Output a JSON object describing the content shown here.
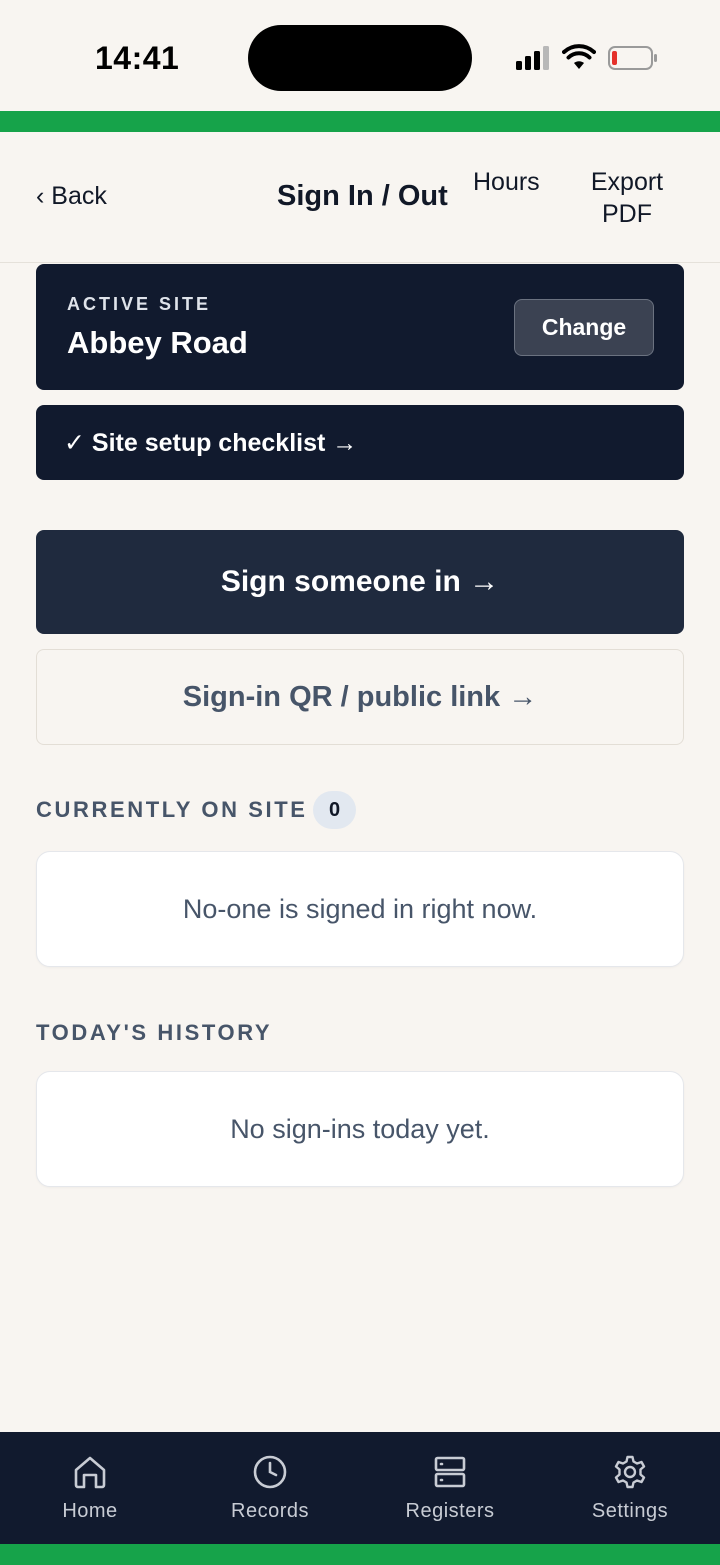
{
  "status": {
    "time": "14:41"
  },
  "header": {
    "back_label": "‹ Back",
    "title": "Sign In / Out",
    "hours_label": "Hours",
    "export_label": "Export PDF"
  },
  "active_site": {
    "label": "ACTIVE SITE",
    "name": "Abbey Road",
    "change_label": "Change"
  },
  "checklist_label": "✓ Site setup checklist →",
  "actions": {
    "sign_in_label": "Sign someone in →",
    "qr_label": "Sign-in QR / public link →"
  },
  "currently_on_site": {
    "label": "CURRENTLY ON SITE",
    "count": "0",
    "empty_text": "No-one is signed in right now."
  },
  "history": {
    "label": "TODAY'S HISTORY",
    "empty_text": "No sign-ins today yet."
  },
  "nav": {
    "items": [
      {
        "label": "Home",
        "icon": "home-icon"
      },
      {
        "label": "Records",
        "icon": "clock-icon"
      },
      {
        "label": "Registers",
        "icon": "server-icon"
      },
      {
        "label": "Settings",
        "icon": "gear-icon"
      }
    ]
  },
  "colors": {
    "accent_green": "#16a34a",
    "navy": "#111a2e",
    "background": "#f8f5f1"
  }
}
